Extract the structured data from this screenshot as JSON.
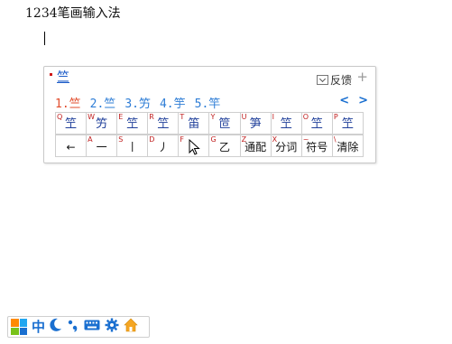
{
  "document": {
    "title": "1234笔画输入法"
  },
  "ime": {
    "composition": "竺",
    "feedback_label": "反馈",
    "pin_symbol": "+",
    "candidates": [
      "1.竺",
      "2.竺",
      "3.竻",
      "4.竽",
      "5.竿"
    ],
    "page_prev": "<",
    "page_next": ">",
    "row1": [
      {
        "key": "Q",
        "value": "笁"
      },
      {
        "key": "W",
        "value": "竻"
      },
      {
        "key": "E",
        "value": "笁"
      },
      {
        "key": "R",
        "value": "笁"
      },
      {
        "key": "T",
        "value": "笛"
      },
      {
        "key": "Y",
        "value": "笸"
      },
      {
        "key": "U",
        "value": "笋"
      },
      {
        "key": "I",
        "value": "笁"
      },
      {
        "key": "O",
        "value": "笁"
      },
      {
        "key": "P",
        "value": "笁"
      }
    ],
    "row2": [
      {
        "key": "",
        "value": "←"
      },
      {
        "key": "A",
        "value": "一"
      },
      {
        "key": "S",
        "value": "丨"
      },
      {
        "key": "D",
        "value": "丿"
      },
      {
        "key": "F",
        "value": ""
      },
      {
        "key": "G",
        "value": "乙"
      },
      {
        "key": "Z",
        "value": "通配"
      },
      {
        "key": "X",
        "value": "分词"
      },
      {
        "key": "~",
        "value": "符号"
      },
      {
        "key": "\\",
        "value": "清除"
      }
    ]
  },
  "status_bar": {
    "mode_label": "中",
    "icons": [
      "moon-icon",
      "punctuation-icon",
      "keyboard-icon",
      "gear-icon",
      "home-icon"
    ]
  }
}
